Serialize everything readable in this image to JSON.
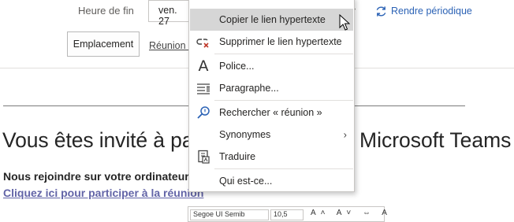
{
  "form": {
    "end_label": "Heure de fin",
    "end_date_value": "ven. 27",
    "recurring_label": "Rendre périodique",
    "location_button": "Emplacement",
    "location_value": "Réunion M"
  },
  "body": {
    "heading_left": "Vous êtes invité à part",
    "heading_right": "Microsoft Teams",
    "join_computer": "Nous rejoindre sur votre ordinateur",
    "join_link": "Cliquez ici pour participer à la réunion"
  },
  "mini_toolbar": {
    "font_value": "Segoe UI Semib",
    "size_value": "10,5",
    "icons": "A˄ A˅ ⇔ A"
  },
  "context_menu": {
    "items": [
      {
        "label": "Copier le lien hypertexte",
        "icon": "none",
        "highlighted": true
      },
      {
        "label": "Supprimer le lien hypertexte",
        "icon": "unlink-icon"
      },
      {
        "label": "Police...",
        "icon": "font-icon"
      },
      {
        "label": "Paragraphe...",
        "icon": "paragraph-icon"
      },
      {
        "label": "Rechercher « réunion »",
        "icon": "search-icon"
      },
      {
        "label": "Synonymes",
        "icon": "none",
        "submenu": true
      },
      {
        "label": "Traduire",
        "icon": "translate-icon"
      },
      {
        "label": "Qui est-ce...",
        "icon": "none"
      }
    ]
  },
  "colors": {
    "link": "#2b62b5",
    "teams_link": "#6264a7",
    "menu_highlight": "#d6d6d6"
  }
}
